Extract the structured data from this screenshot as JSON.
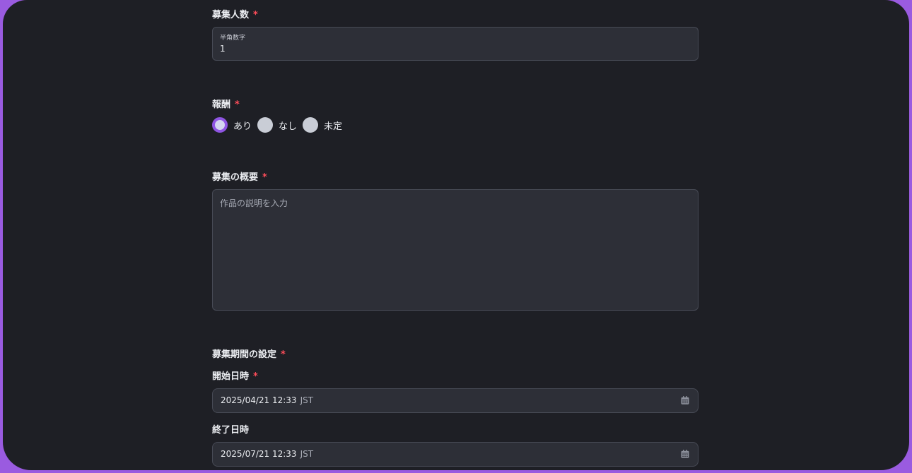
{
  "recruit_count": {
    "label": "募集人数",
    "required_mark": "*",
    "hint": "半角数字",
    "value": "1"
  },
  "reward": {
    "label": "報酬",
    "required_mark": "*",
    "options": [
      {
        "label": "あり",
        "selected": true
      },
      {
        "label": "なし",
        "selected": false
      },
      {
        "label": "未定",
        "selected": false
      }
    ]
  },
  "overview": {
    "label": "募集の概要",
    "required_mark": "*",
    "placeholder": "作品の説明を入力"
  },
  "period": {
    "label": "募集期間の設定",
    "required_mark": "*",
    "start": {
      "label": "開始日時",
      "required_mark": "*",
      "value": "2025/04/21 12:33",
      "tz": "JST"
    },
    "end": {
      "label": "終了日時",
      "value": "2025/07/21 12:33",
      "tz": "JST"
    }
  },
  "colors": {
    "accent": "#8f55e3",
    "required": "#ff4d5a",
    "background": "#1e1f25",
    "field_bg": "#2d2f37"
  },
  "icons": [
    "calendar-icon"
  ]
}
